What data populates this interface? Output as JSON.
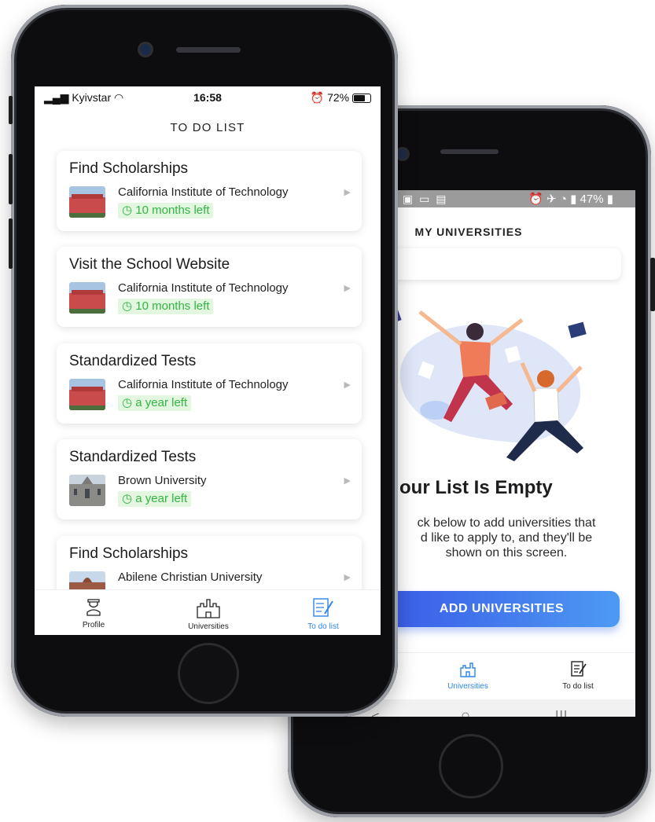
{
  "front": {
    "status": {
      "carrier": "Kyivstar",
      "time": "16:58",
      "battery": "72%"
    },
    "title": "TO DO LIST",
    "tasks": [
      {
        "title": "Find Scholarships",
        "school": "California Institute of Technology",
        "due": "10 months left",
        "thumb": "red"
      },
      {
        "title": "Visit the School Website",
        "school": "California Institute of Technology",
        "due": "10 months left",
        "thumb": "red"
      },
      {
        "title": "Standardized Tests",
        "school": "California Institute of Technology",
        "due": "a year left",
        "thumb": "red"
      },
      {
        "title": "Standardized Tests",
        "school": "Brown University",
        "due": "a year left",
        "thumb": "stone"
      },
      {
        "title": "Find Scholarships",
        "school": "Abilene Christian University",
        "due": "",
        "thumb": "dome"
      }
    ],
    "tabs": [
      {
        "label": "Profile",
        "icon": "graduate-icon"
      },
      {
        "label": "Universities",
        "icon": "castle-icon"
      },
      {
        "label": "To do list",
        "icon": "checklist-icon"
      }
    ],
    "active_tab_color": "#2d86e8"
  },
  "back": {
    "status_right": "47%",
    "title": "MY UNIVERSITIES",
    "empty_title": "our List Is Empty",
    "empty_body": "ck below to add universities that\nd like to apply to, and they'll be\nshown on this screen.",
    "cta": "ADD UNIVERSITIES",
    "tabs": [
      {
        "label": "Universities",
        "icon": "castle-icon"
      },
      {
        "label": "To do list",
        "icon": "checklist-icon"
      }
    ],
    "navbar": [
      "<",
      "○",
      "III"
    ]
  },
  "colors": {
    "badge_bg": "#e3f6e0",
    "badge_text": "#32b543",
    "cta_start": "#3a5ce8",
    "cta_end": "#4d9af2"
  }
}
